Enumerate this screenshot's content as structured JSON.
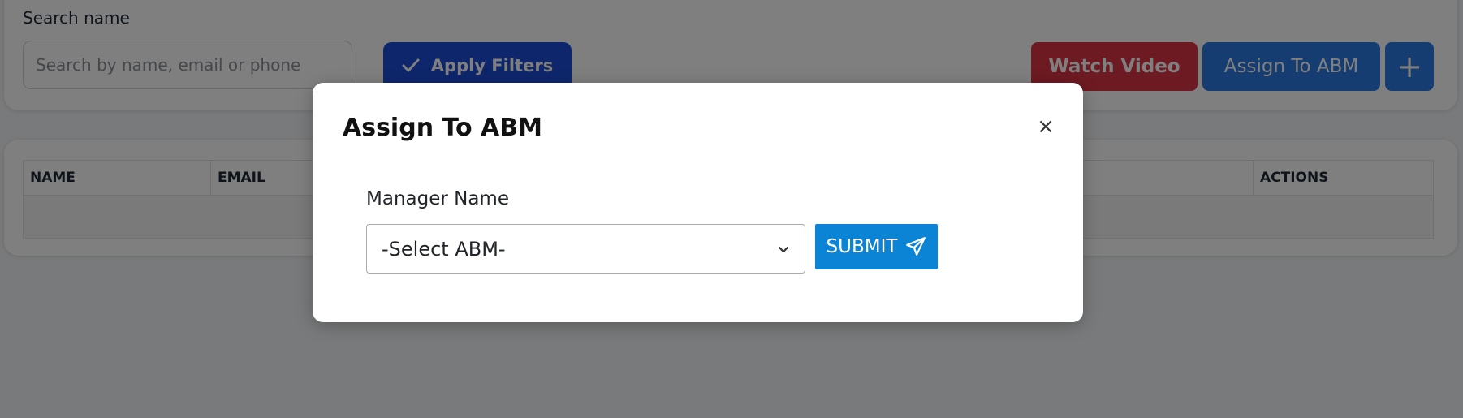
{
  "filters": {
    "search_label": "Search name",
    "search_placeholder": "Search by name, email or phone",
    "apply_label": "Apply Filters",
    "watch_video_label": "Watch Video",
    "assign_label": "Assign To ABM",
    "add_label": "+"
  },
  "table": {
    "columns": [
      "NAME",
      "EMAIL",
      "",
      "",
      "",
      "ACTIONS"
    ]
  },
  "modal": {
    "title": "Assign To ABM",
    "close_label": "×",
    "field_label": "Manager Name",
    "select_value": "-Select ABM-",
    "submit_label": "SUBMIT"
  },
  "colors": {
    "apply": "#1d4ed8",
    "watch_video": "#dc3545",
    "assign": "#2b7be4",
    "submit": "#0b84d6",
    "backdrop": "rgba(0,0,0,0.5)"
  },
  "icons": {
    "apply": "check-icon",
    "submit": "paper-plane-icon",
    "select": "chevron-down-icon",
    "close": "close-icon",
    "add": "plus-icon"
  }
}
